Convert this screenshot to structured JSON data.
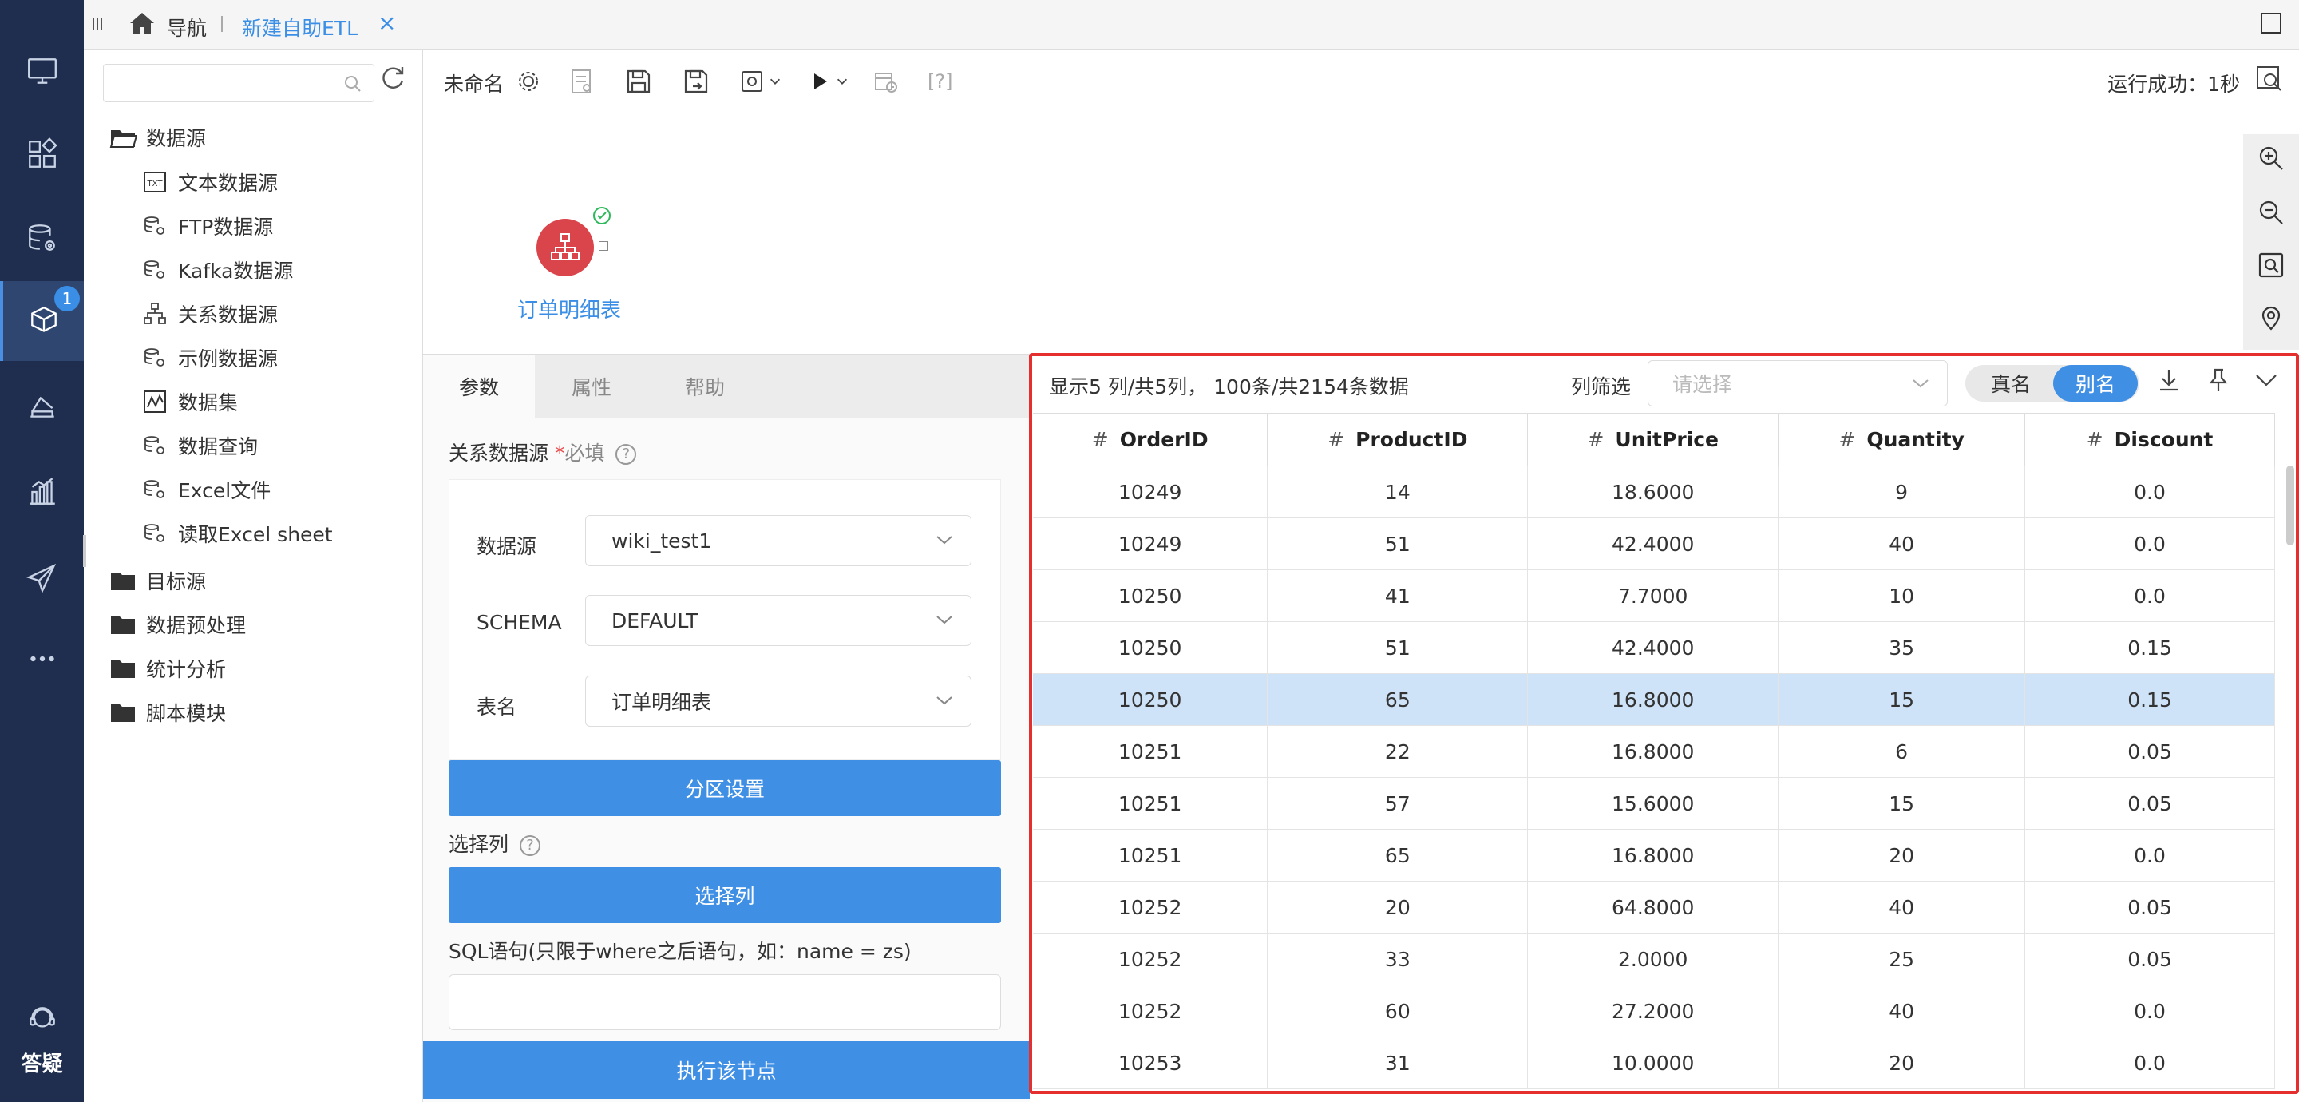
{
  "topbar": {
    "nav_label": "导航",
    "active_tab": "新建自助ETL",
    "close_glyph": "×"
  },
  "leftbar": {
    "badge": "1",
    "help_label": "答疑"
  },
  "tree": {
    "search_placeholder": "",
    "root_datasource": "数据源",
    "datasource_children": [
      "文本数据源",
      "FTP数据源",
      "Kafka数据源",
      "关系数据源",
      "示例数据源",
      "数据集",
      "数据查询",
      "Excel文件",
      "读取Excel sheet"
    ],
    "folders": [
      "目标源",
      "数据预处理",
      "统计分析",
      "脚本模块"
    ]
  },
  "toolbar": {
    "flow_name": "未命名",
    "help_glyph": "[?]",
    "run_status": "运行成功：1秒"
  },
  "canvas": {
    "node_label": "订单明细表"
  },
  "params": {
    "tabs": [
      "参数",
      "属性",
      "帮助"
    ],
    "rel_source_label": "关系数据源",
    "required_mark": "*",
    "required_text": "必填",
    "help_q": "?",
    "fields": [
      {
        "label": "数据源",
        "value": "wiki_test1"
      },
      {
        "label": "SCHEMA",
        "value": "DEFAULT"
      },
      {
        "label": "表名",
        "value": "订单明细表"
      }
    ],
    "partition_button": "分区设置",
    "select_cols_label": "选择列",
    "select_cols_button": "选择列",
    "sql_label": "SQL语句(只限于where之后语句，如：name = zs)",
    "sql_value": "",
    "execute_button": "执行该节点"
  },
  "preview": {
    "info": "显示5 列/共5列， 100条/共2154条数据",
    "filter_label": "列筛选",
    "filter_placeholder": "请选择",
    "toggle": [
      "真名",
      "别名"
    ],
    "columns": [
      "OrderID",
      "ProductID",
      "UnitPrice",
      "Quantity",
      "Discount"
    ],
    "hash": "#",
    "rows": [
      [
        "10249",
        "14",
        "18.6000",
        "9",
        "0.0"
      ],
      [
        "10249",
        "51",
        "42.4000",
        "40",
        "0.0"
      ],
      [
        "10250",
        "41",
        "7.7000",
        "10",
        "0.0"
      ],
      [
        "10250",
        "51",
        "42.4000",
        "35",
        "0.15"
      ],
      [
        "10250",
        "65",
        "16.8000",
        "15",
        "0.15"
      ],
      [
        "10251",
        "22",
        "16.8000",
        "6",
        "0.05"
      ],
      [
        "10251",
        "57",
        "15.6000",
        "15",
        "0.05"
      ],
      [
        "10251",
        "65",
        "16.8000",
        "20",
        "0.0"
      ],
      [
        "10252",
        "20",
        "64.8000",
        "40",
        "0.05"
      ],
      [
        "10252",
        "33",
        "2.0000",
        "25",
        "0.05"
      ],
      [
        "10252",
        "60",
        "27.2000",
        "40",
        "0.0"
      ],
      [
        "10253",
        "31",
        "10.0000",
        "20",
        "0.0"
      ]
    ],
    "selected_row_index": 4
  },
  "colors": {
    "sidebar": "#1f2d4e",
    "accent": "#3f8fe5",
    "node": "#d9454a",
    "highlight_frame": "#e52e2e",
    "selected_row": "#cfe3f8"
  }
}
